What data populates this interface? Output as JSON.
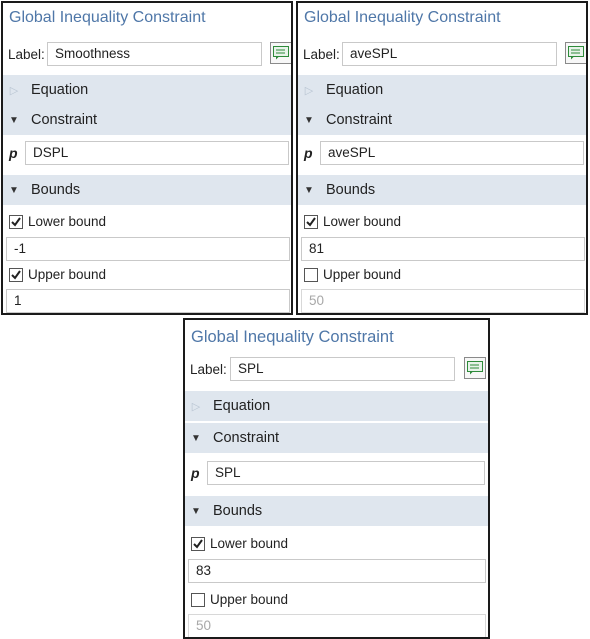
{
  "panels": [
    {
      "title": "Global Inequality Constraint",
      "label_caption": "Label:",
      "label_value": "Smoothness",
      "sections": {
        "equation": "Equation",
        "constraint": "Constraint",
        "bounds": "Bounds"
      },
      "constraint_symbol": "p",
      "constraint_value": "DSPL",
      "lower_bound": {
        "label": "Lower bound",
        "checked": true,
        "value": "-1"
      },
      "upper_bound": {
        "label": "Upper bound",
        "checked": true,
        "value": "1"
      }
    },
    {
      "title": "Global Inequality Constraint",
      "label_caption": "Label:",
      "label_value": "aveSPL",
      "sections": {
        "equation": "Equation",
        "constraint": "Constraint",
        "bounds": "Bounds"
      },
      "constraint_symbol": "p",
      "constraint_value": "aveSPL",
      "lower_bound": {
        "label": "Lower bound",
        "checked": true,
        "value": "81"
      },
      "upper_bound": {
        "label": "Upper bound",
        "checked": false,
        "value": "50"
      }
    },
    {
      "title": "Global Inequality Constraint",
      "label_caption": "Label:",
      "label_value": "SPL",
      "sections": {
        "equation": "Equation",
        "constraint": "Constraint",
        "bounds": "Bounds"
      },
      "constraint_symbol": "p",
      "constraint_value": "SPL",
      "lower_bound": {
        "label": "Lower bound",
        "checked": true,
        "value": "83"
      },
      "upper_bound": {
        "label": "Upper bound",
        "checked": false,
        "value": "50"
      }
    }
  ],
  "icons": {
    "rename_button": "label-edit-icon",
    "collapsed_arrow": "triangle-right-icon",
    "expanded_arrow": "triangle-down-icon",
    "checkmark": "checkmark-icon"
  },
  "colors": {
    "title": "#4f77a8",
    "section_bg": "#dfe6ee",
    "border": "#1a1a1a",
    "icon_green": "#2e8b3a"
  }
}
